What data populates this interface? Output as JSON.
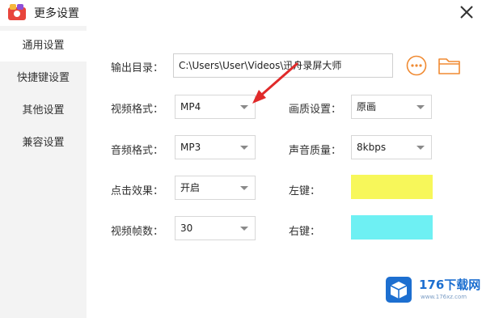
{
  "window": {
    "title": "更多设置"
  },
  "sidebar": {
    "items": [
      {
        "label": "通用设置"
      },
      {
        "label": "快捷键设置"
      },
      {
        "label": "其他设置"
      },
      {
        "label": "兼容设置"
      }
    ]
  },
  "form": {
    "output_dir": {
      "label": "输出目录：",
      "value": "C:\\Users\\User\\Videos\\迅舟录屏大师",
      "more_icon": "ellipsis-circle-icon",
      "folder_icon": "folder-icon"
    },
    "video_format": {
      "label": "视频格式：",
      "value": "MP4"
    },
    "quality": {
      "label": "画质设置：",
      "value": "原画"
    },
    "audio_format": {
      "label": "音频格式：",
      "value": "MP3"
    },
    "audio_quality": {
      "label": "声音质量：",
      "value": "8kbps"
    },
    "click_effect": {
      "label": "点击效果：",
      "value": "开启"
    },
    "left_key": {
      "label": "左键：",
      "color": "#f7f75a"
    },
    "frame_rate": {
      "label": "视频帧数：",
      "value": "30"
    },
    "right_key": {
      "label": "右键：",
      "color": "#6ef0f3"
    }
  },
  "colors": {
    "accent_orange": "#f08a32",
    "annotation_red": "#e02a2a",
    "sidebar_bg": "#f3f3f3"
  },
  "watermark": {
    "text": "176下载网",
    "sub": "www.176xz.com"
  }
}
